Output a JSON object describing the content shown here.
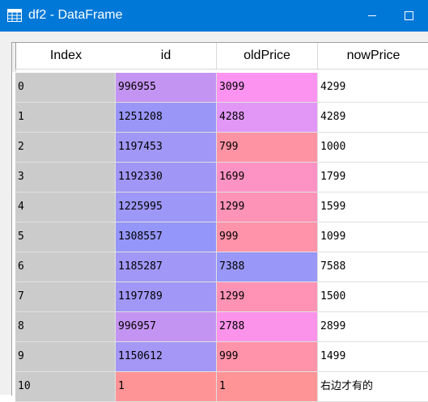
{
  "window": {
    "title": "df2 - DataFrame"
  },
  "table": {
    "columns": [
      "Index",
      "id",
      "oldPrice",
      "nowPrice"
    ],
    "rows": [
      {
        "index": "0",
        "id": "996955",
        "oldPrice": "3099",
        "nowPrice": "4299",
        "id_color": "#c494f2",
        "old_color": "#fd93f1"
      },
      {
        "index": "1",
        "id": "1251208",
        "oldPrice": "4288",
        "nowPrice": "4289",
        "id_color": "#9a96f8",
        "old_color": "#e297f6"
      },
      {
        "index": "2",
        "id": "1197453",
        "oldPrice": "799",
        "nowPrice": "1000",
        "id_color": "#a097f6",
        "old_color": "#fe93a4"
      },
      {
        "index": "3",
        "id": "1192330",
        "oldPrice": "1699",
        "nowPrice": "1799",
        "id_color": "#a096f6",
        "old_color": "#fd93c4"
      },
      {
        "index": "4",
        "id": "1225995",
        "oldPrice": "1299",
        "nowPrice": "1599",
        "id_color": "#9d97f7",
        "old_color": "#fe93b8"
      },
      {
        "index": "5",
        "id": "1308557",
        "oldPrice": "999",
        "nowPrice": "1099",
        "id_color": "#9496f9",
        "old_color": "#fe93a9"
      },
      {
        "index": "6",
        "id": "1185287",
        "oldPrice": "7388",
        "nowPrice": "7588",
        "id_color": "#a097f6",
        "old_color": "#9997f8"
      },
      {
        "index": "7",
        "id": "1197789",
        "oldPrice": "1299",
        "nowPrice": "1500",
        "id_color": "#a097f6",
        "old_color": "#fe93b6"
      },
      {
        "index": "8",
        "id": "996957",
        "oldPrice": "2788",
        "nowPrice": "2899",
        "id_color": "#c494f2",
        "old_color": "#fc93ea"
      },
      {
        "index": "9",
        "id": "1150612",
        "oldPrice": "999",
        "nowPrice": "1499",
        "id_color": "#a497f5",
        "old_color": "#fe93a9"
      },
      {
        "index": "10",
        "id": "1",
        "oldPrice": "1",
        "nowPrice": "右边才有的",
        "id_color": "#ff9497",
        "old_color": "#ff9497"
      }
    ]
  },
  "icons": {
    "title": "grid-table-icon",
    "minimize": "minimize-icon",
    "maximize": "maximize-icon"
  }
}
